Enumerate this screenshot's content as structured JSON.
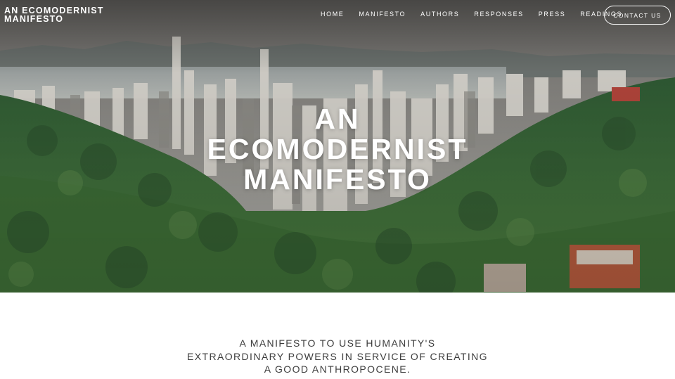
{
  "header": {
    "site_title_line1": "AN ECOMODERNIST",
    "site_title_line2": "MANIFESTO"
  },
  "nav": {
    "items": [
      "HOME",
      "MANIFESTO",
      "AUTHORS",
      "RESPONSES",
      "PRESS",
      "READINGS"
    ],
    "contact_label": "CONTACT US"
  },
  "hero": {
    "heading_line1": "AN",
    "heading_line2": "ECOMODERNIST",
    "heading_line3": "MANIFESTO",
    "image_subject": "city skyline above forested hills"
  },
  "intro": {
    "line1": "A MANIFESTO TO USE HUMANITY'S",
    "line2": "EXTRAORDINARY POWERS IN SERVICE OF CREATING",
    "line3": "A GOOD ANTHROPOCENE."
  },
  "colors": {
    "text_on_image": "#ffffff",
    "tagline_text": "#3d3d3d",
    "forest_green": "#3f6a3a",
    "sky_gray": "#8a8a86"
  }
}
